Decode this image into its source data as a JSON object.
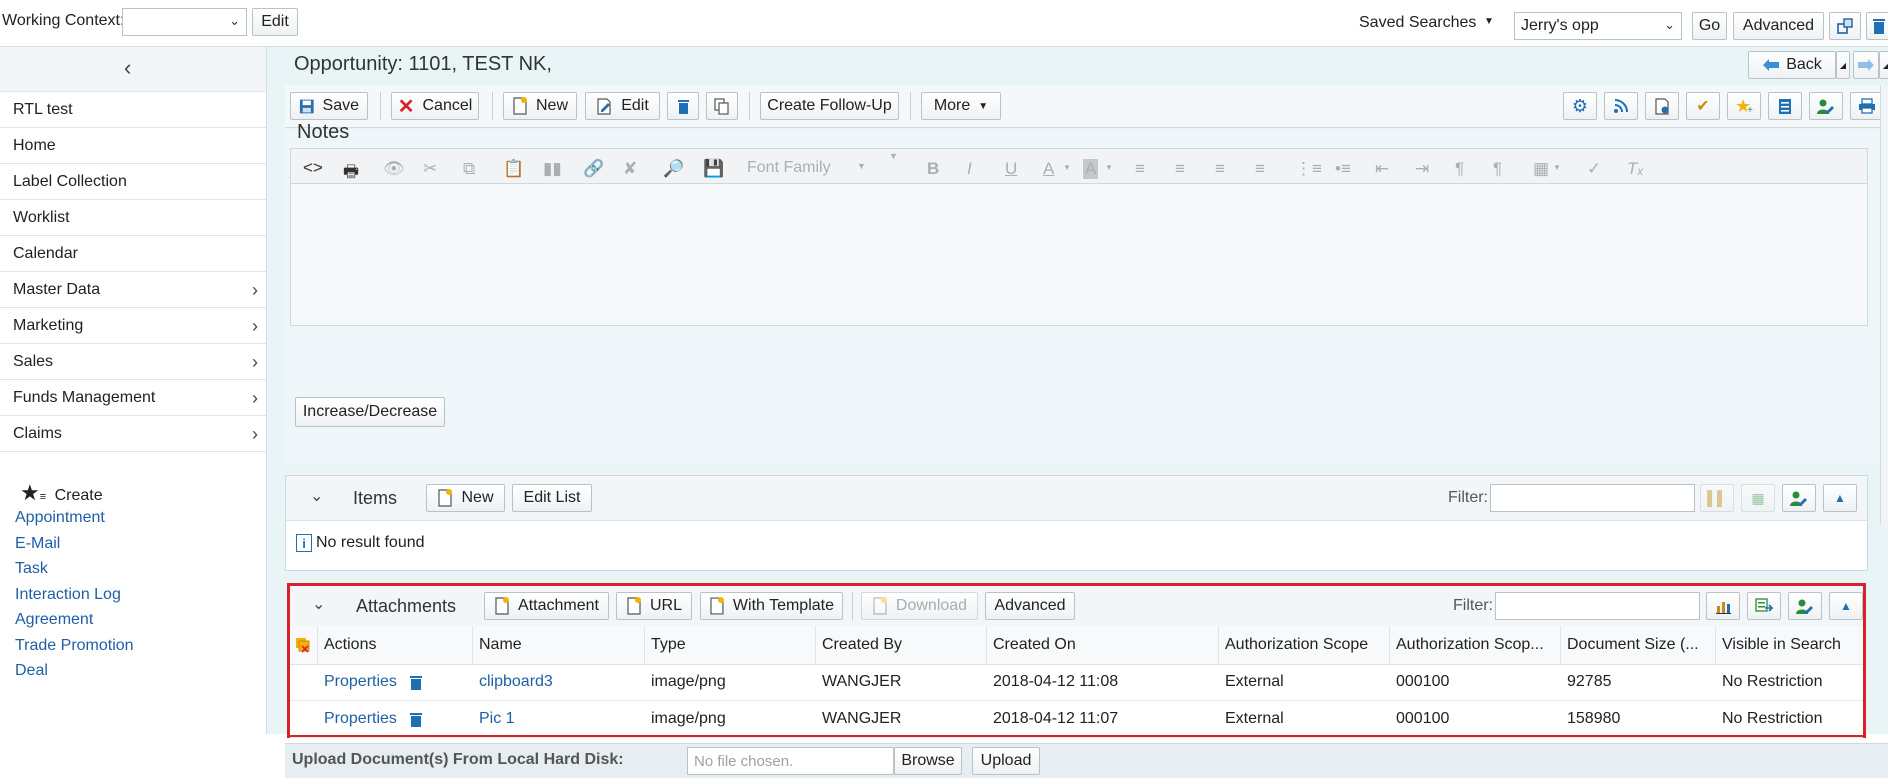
{
  "topbar": {
    "working_context_label": "Working Context:",
    "edit_label": "Edit",
    "saved_searches_label": "Saved Searches",
    "saved_search_value": "Jerry's opp",
    "go_label": "Go",
    "advanced_label": "Advanced"
  },
  "sidebar": {
    "items": [
      {
        "label": "RTL test",
        "has_arrow": false
      },
      {
        "label": "Home",
        "has_arrow": false
      },
      {
        "label": "Label Collection",
        "has_arrow": false
      },
      {
        "label": "Worklist",
        "has_arrow": false
      },
      {
        "label": "Calendar",
        "has_arrow": false
      },
      {
        "label": "Master Data",
        "has_arrow": true
      },
      {
        "label": "Marketing",
        "has_arrow": true
      },
      {
        "label": "Sales",
        "has_arrow": true
      },
      {
        "label": "Funds Management",
        "has_arrow": true
      },
      {
        "label": "Claims",
        "has_arrow": true
      }
    ],
    "create": {
      "label": "Create",
      "links": [
        "Appointment",
        "E-Mail",
        "Task",
        "Interaction Log",
        "Agreement",
        "Trade Promotion",
        "Deal"
      ]
    }
  },
  "header": {
    "title": "Opportunity: 1101, TEST NK,",
    "back_label": "Back"
  },
  "toolbar": {
    "save_label": "Save",
    "cancel_label": "Cancel",
    "new_label": "New",
    "edit_label": "Edit",
    "follow_up_label": "Create Follow-Up",
    "more_label": "More"
  },
  "notes": {
    "title": "Notes",
    "font_family_label": "Font Family",
    "increase_label": "Increase/Decrease"
  },
  "items": {
    "title": "Items",
    "new_label": "New",
    "edit_list_label": "Edit List",
    "filter_label": "Filter:",
    "empty_message": "No result found"
  },
  "attachments": {
    "title": "Attachments",
    "attachment_label": "Attachment",
    "url_label": "URL",
    "template_label": "With Template",
    "download_label": "Download",
    "advanced_label": "Advanced",
    "filter_label": "Filter:",
    "columns": [
      "Actions",
      "Name",
      "Type",
      "Created By",
      "Created On",
      "Authorization Scope",
      "Authorization Scop...",
      "Document Size (...",
      "Visible in Search"
    ],
    "rows": [
      {
        "action": "Properties",
        "name": "clipboard3",
        "type": "image/png",
        "created_by": "WANGJER",
        "created_on": "2018-04-12 11:08",
        "auth_scope": "External",
        "auth_scope2": "000100",
        "size": "92785",
        "visible": "No Restriction"
      },
      {
        "action": "Properties",
        "name": "Pic 1",
        "type": "image/png",
        "created_by": "WANGJER",
        "created_on": "2018-04-12 11:07",
        "auth_scope": "External",
        "auth_scope2": "000100",
        "size": "158980",
        "visible": "No Restriction"
      }
    ]
  },
  "upload": {
    "label": "Upload Document(s) From Local Hard Disk:",
    "placeholder": "No file chosen.",
    "browse_label": "Browse",
    "upload_label": "Upload"
  },
  "colors": {
    "link": "#1f5fa5",
    "highlight": "#d9212a",
    "main_bg": "#e9f4f7"
  }
}
